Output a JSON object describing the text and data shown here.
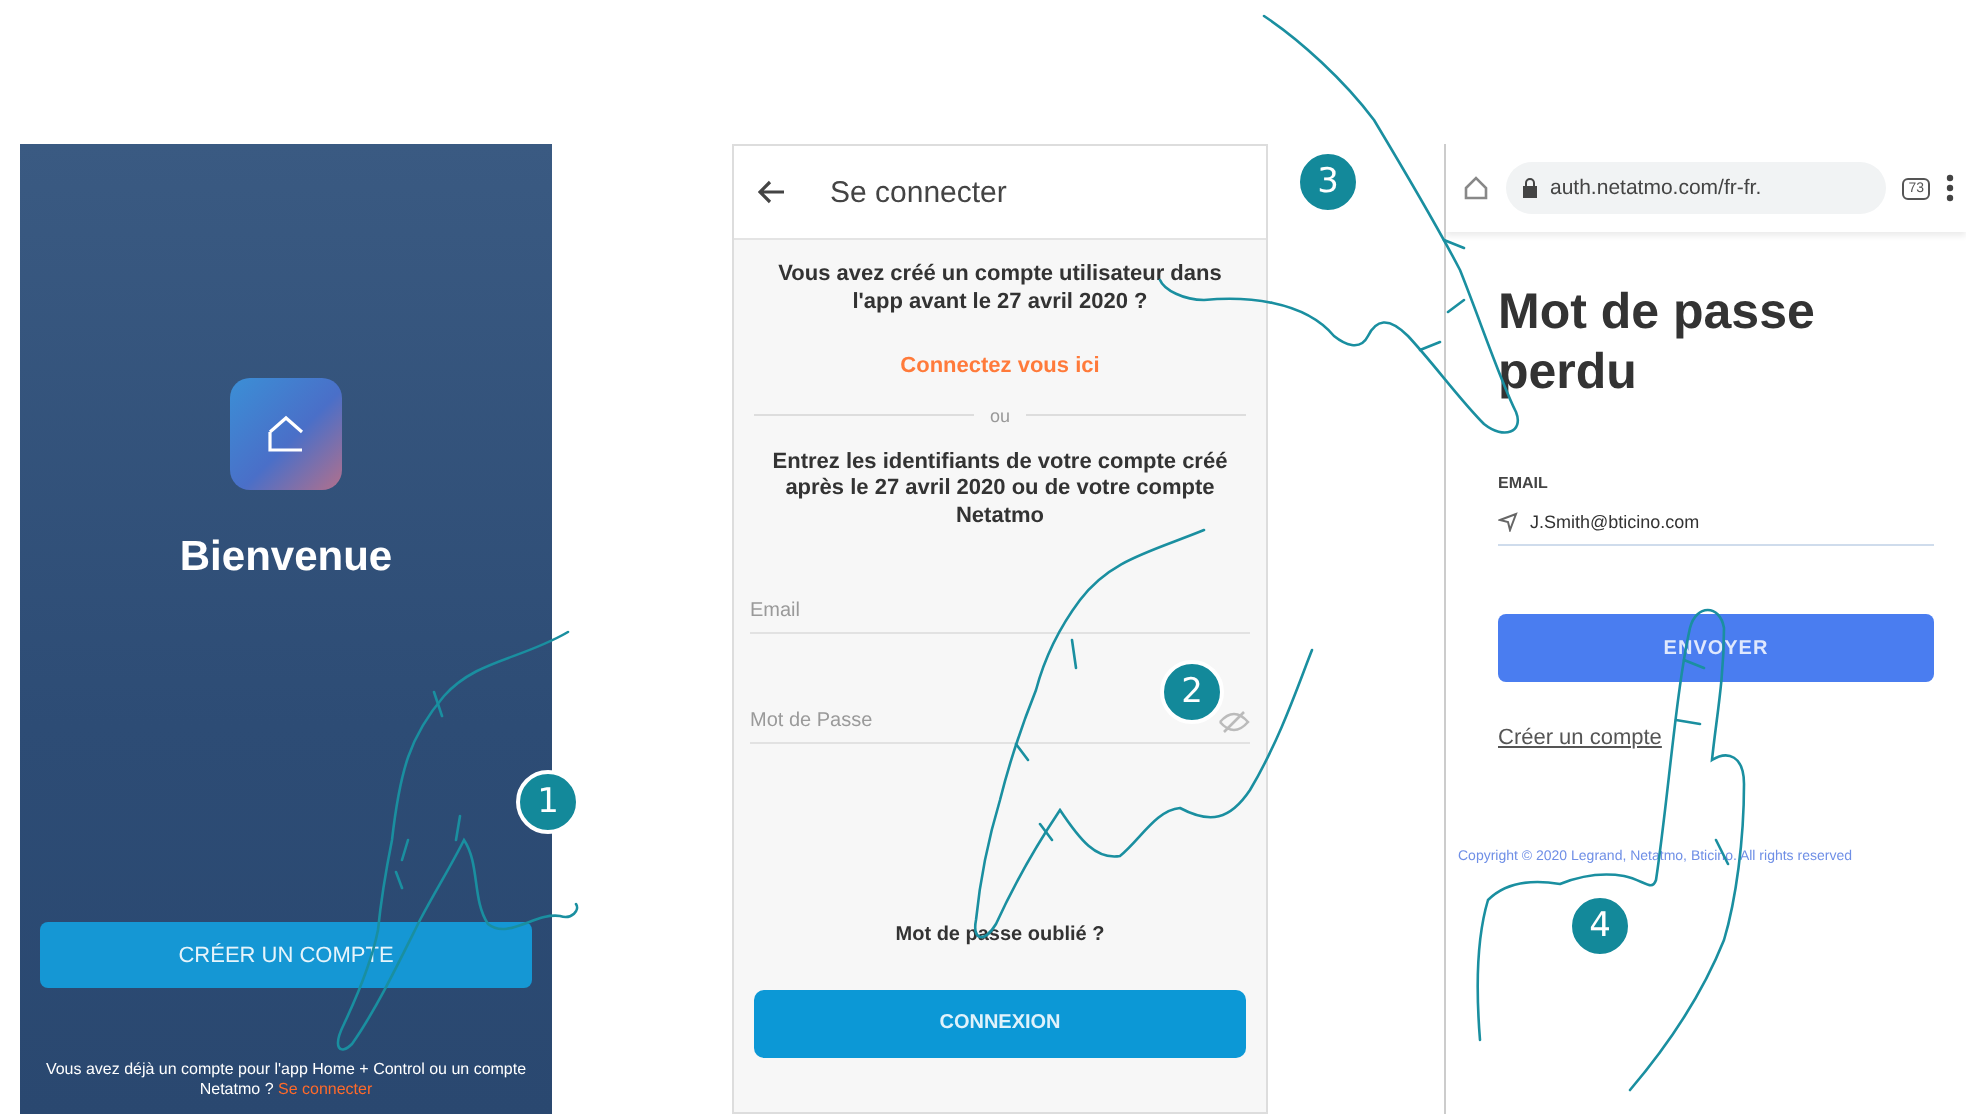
{
  "welcome_screen": {
    "title": "Bienvenue",
    "create_button": "CRÉER UN COMPTE",
    "footer_text": "Vous avez déjà un compte pour l'app Home + Control ou un compte Netatmo ?",
    "footer_link": "Se connecter"
  },
  "login_screen": {
    "header_title": "Se connecter",
    "question": "Vous avez créé un compte utilisateur dans l'app avant le 27 avril 2020 ?",
    "legacy_link": "Connectez vous ici",
    "divider_text": "ou",
    "instructions": "Entrez les identifiants de votre compte créé après le 27 avril 2020 ou de votre compte Netatmo",
    "email_field": {
      "placeholder": "Email"
    },
    "password_field": {
      "placeholder": "Mot de Passe"
    },
    "forgot_link": "Mot de passe oublié ?",
    "login_button": "CONNEXION"
  },
  "reset_screen": {
    "url": "auth.netatmo.com/fr-fr.",
    "tab_count": "73",
    "title": "Mot de passe perdu",
    "email_label": "EMAIL",
    "email_field": {
      "value": "J.Smith@bticino.com"
    },
    "send_button": "ENVOYER",
    "create_link": "Créer un compte",
    "copyright": "Copyright © 2020 Legrand, Netatmo, Bticino. All rights reserved"
  },
  "step_badges": [
    "1",
    "2",
    "3",
    "4"
  ]
}
